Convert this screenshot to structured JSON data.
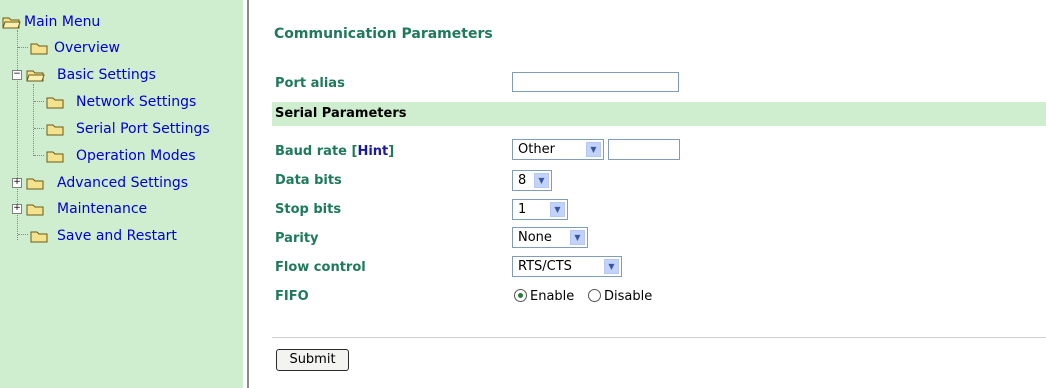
{
  "sidebar": {
    "main_menu": "Main Menu",
    "items": {
      "overview": "Overview",
      "basic_settings": "Basic Settings",
      "network_settings": "Network Settings",
      "serial_port_settings": "Serial Port Settings",
      "operation_modes": "Operation Modes",
      "advanced_settings": "Advanced Settings",
      "maintenance": "Maintenance",
      "save_and_restart": "Save and Restart"
    }
  },
  "main": {
    "title": "Communication Parameters",
    "port_alias": {
      "label": "Port alias",
      "value": ""
    },
    "serial_section": "Serial Parameters",
    "baud_rate": {
      "label": "Baud rate",
      "hint_open": "[",
      "hint": "Hint",
      "hint_close": "]",
      "selected": "Other",
      "custom_value": ""
    },
    "data_bits": {
      "label": "Data bits",
      "selected": "8"
    },
    "stop_bits": {
      "label": "Stop bits",
      "selected": "1"
    },
    "parity": {
      "label": "Parity",
      "selected": "None"
    },
    "flow_control": {
      "label": "Flow control",
      "selected": "RTS/CTS"
    },
    "fifo": {
      "label": "FIFO",
      "enable": "Enable",
      "disable": "Disable",
      "selected": "Enable"
    },
    "submit": "Submit"
  },
  "colors": {
    "sidebar_bg": "#cfeecf",
    "label_green": "#1e7a5a",
    "link_blue": "#0000d0",
    "hint_blue": "#1a1aa0"
  }
}
